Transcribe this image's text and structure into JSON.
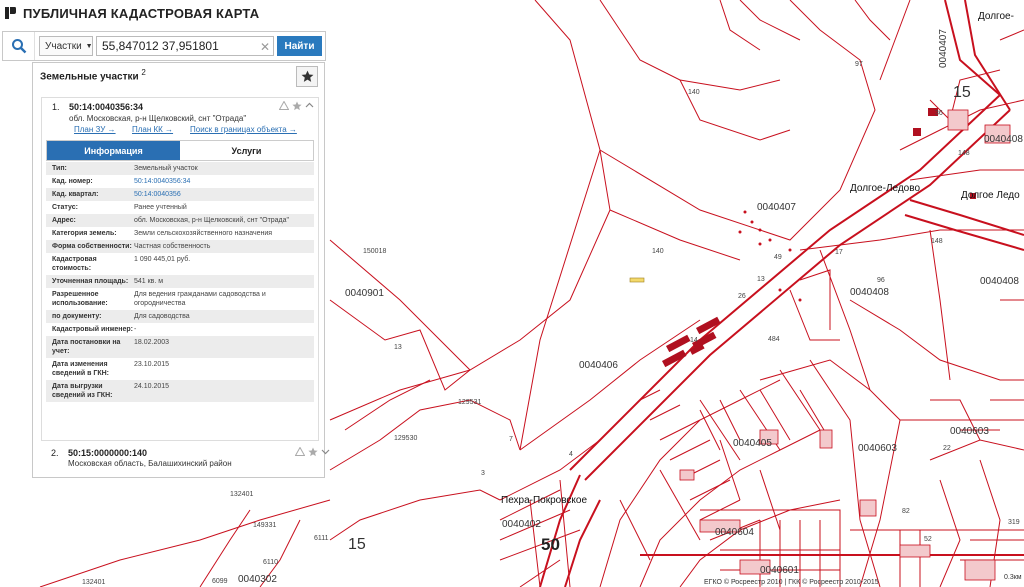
{
  "app": {
    "title": "ПУБЛИЧНАЯ КАДАСТРОВАЯ КАРТА"
  },
  "search": {
    "type_label": "Участки",
    "query": "55,847012 37,951801",
    "button_label": "Найти"
  },
  "panel": {
    "title": "Земельные участки",
    "count": "2",
    "results": [
      {
        "index": "1.",
        "cad_number": "50:14:0040356:34",
        "address": "обл. Московская, р-н Щелковский, снт \"Отрада\"",
        "links": [
          "План ЗУ →",
          "План КК →",
          "Поиск в границах объекта →"
        ],
        "tabs": [
          "Информация",
          "Услуги"
        ],
        "active_tab": "Информация",
        "attributes": [
          {
            "name": "Тип:",
            "value": "Земельный участок"
          },
          {
            "name": "Кад. номер:",
            "value": "50:14:0040356:34",
            "link": true
          },
          {
            "name": "Кад. квартал:",
            "value": "50:14:0040356",
            "link": true
          },
          {
            "name": "Статус:",
            "value": "Ранее учтенный"
          },
          {
            "name": "Адрес:",
            "value": "обл. Московская, р-н Щелковский, снт \"Отрада\""
          },
          {
            "name": "Категория земель:",
            "value": "Земли сельскохозяйственного назначения"
          },
          {
            "name": "Форма собственности:",
            "value": "Частная собственность"
          },
          {
            "name": "Кадастровая стоимость:",
            "value": "1 090 445,01 руб."
          },
          {
            "name": "Уточненная площадь:",
            "value": "541 кв. м"
          },
          {
            "name": "Разрешенное использование:",
            "value": "Для ведения гражданами садоводства и огородничества"
          },
          {
            "name": "по документу:",
            "value": "Для садоводства"
          },
          {
            "name": "Кадастровый инженер:",
            "value": "-"
          },
          {
            "name": "Дата постановки на учет:",
            "value": "18.02.2003"
          },
          {
            "name": "Дата изменения сведений в ГКН:",
            "value": "23.10.2015"
          },
          {
            "name": "Дата выгрузки сведений из ГКН:",
            "value": "24.10.2015"
          }
        ]
      },
      {
        "index": "2.",
        "cad_number": "50:15:0000000:140",
        "address": "Московская область, Балашихинский район"
      }
    ]
  },
  "map": {
    "line_color": "#c8101e",
    "fill_color": "#f3c9cc",
    "places": [
      "Долгое-Ледово",
      "Долгое Ледо",
      "Пехра-Покровское",
      "Долгое-"
    ],
    "quarters": [
      "0040407",
      "0040408",
      "0040408",
      "0040408",
      "0040901",
      "0040406",
      "0040405",
      "0040603",
      "0040603",
      "0040402",
      "0040604",
      "0040601",
      "0040302",
      "0040407"
    ],
    "parcels": [
      "97",
      "140",
      "140",
      "36",
      "148",
      "150018",
      "96",
      "26",
      "49",
      "13",
      "484",
      "129531",
      "129530",
      "7",
      "3",
      "4",
      "132401",
      "149331",
      "6111",
      "6110",
      "6099",
      "132401",
      "82",
      "319",
      "148",
      "22",
      "13",
      "14",
      "17",
      "52"
    ],
    "roads": [
      "15",
      "15",
      "50"
    ],
    "scale": "0.3км",
    "copyright": "ЕГКО © Росреестр 2010 | ГКК © Росреестр 2010-2015"
  }
}
